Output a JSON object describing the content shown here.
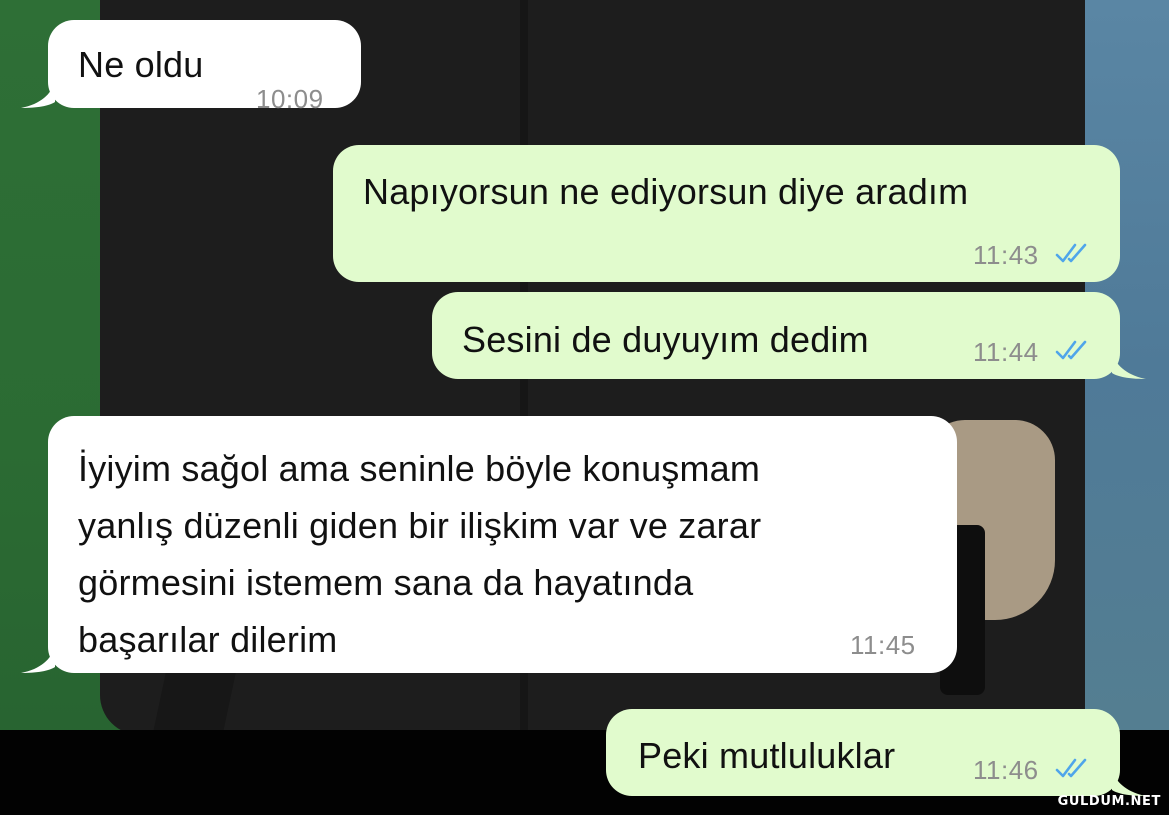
{
  "messages": [
    {
      "direction": "incoming",
      "text": "Ne oldu",
      "time": "10:09"
    },
    {
      "direction": "outgoing",
      "text": "Napıyorsun ne ediyorsun diye aradım",
      "time": "11:43",
      "status_icon": "double-check-read-icon"
    },
    {
      "direction": "outgoing",
      "text": "Sesini de duyuyım dedim",
      "time": "11:44",
      "status_icon": "double-check-read-icon"
    },
    {
      "direction": "incoming",
      "lines": [
        "İyiyim sağol ama seninle böyle konuşmam",
        "yanlış düzenli giden bir ilişkim var ve zarar",
        "görmesini istemem sana da hayatında",
        "başarılar dilerim"
      ],
      "time": "11:45"
    },
    {
      "direction": "outgoing",
      "text": "Peki mutluluklar",
      "time": "11:46",
      "status_icon": "double-check-read-icon"
    }
  ],
  "watermark": "GULDUM.NET",
  "colors": {
    "incoming_bubble": "#ffffff",
    "outgoing_bubble": "#e1fbcd",
    "read_ticks": "#4fa5ea",
    "timestamp": "#8d8d8d"
  }
}
